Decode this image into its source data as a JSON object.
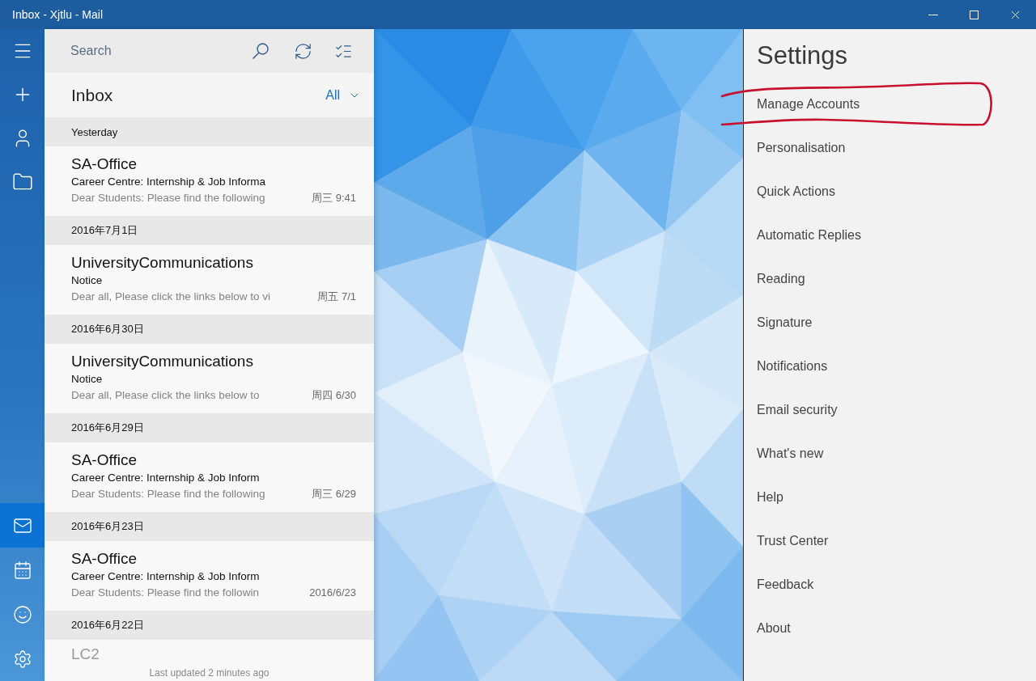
{
  "window": {
    "title": "Inbox - Xjtlu - Mail"
  },
  "nav_rail": {
    "apps": [
      {
        "kind": "mail",
        "selected": true
      },
      {
        "kind": "calendar",
        "selected": false
      },
      {
        "kind": "feedback",
        "selected": false
      },
      {
        "kind": "settings",
        "selected": false
      }
    ]
  },
  "message_list": {
    "search": {
      "placeholder": "Search"
    },
    "folder": "Inbox",
    "filter": "All",
    "groups": [
      {
        "heading": "Yesterday",
        "messages": [
          {
            "kind": "full",
            "sender": "SA-Office",
            "subject": "Career Centre: Internship & Job Informa",
            "preview": "Dear Students: Please find the following",
            "date": "周三 9:41"
          }
        ]
      },
      {
        "heading": "2016年7月1日",
        "messages": [
          {
            "kind": "full",
            "sender": "UniversityCommunications",
            "subject": "Notice",
            "preview": "Dear all, Please click the links below to vi",
            "date": "周五 7/1"
          }
        ]
      },
      {
        "heading": "2016年6月30日",
        "messages": [
          {
            "kind": "full",
            "sender": "UniversityCommunications",
            "subject": "Notice",
            "preview": "Dear all, Please click the links below to",
            "date": "周四 6/30"
          }
        ]
      },
      {
        "heading": "2016年6月29日",
        "messages": [
          {
            "kind": "full",
            "sender": "SA-Office",
            "subject": "Career Centre: Internship & Job Inform",
            "preview": "Dear Students: Please find the following",
            "date": "周三 6/29"
          }
        ]
      },
      {
        "heading": "2016年6月23日",
        "messages": [
          {
            "kind": "full",
            "sender": "SA-Office",
            "subject": "Career Centre: Internship & Job Inform",
            "preview": "Dear Students: Please find the followin",
            "date": "2016/6/23"
          }
        ]
      },
      {
        "heading": "2016年6月22日",
        "messages": [
          {
            "kind": "partial",
            "sender": "LC2"
          }
        ]
      }
    ],
    "status": "Last updated 2 minutes ago"
  },
  "settings": {
    "title": "Settings",
    "items": [
      {
        "label": "Manage Accounts",
        "circled": true
      },
      {
        "label": "Personalisation",
        "circled": false
      },
      {
        "label": "Quick Actions",
        "circled": false
      },
      {
        "label": "Automatic Replies",
        "circled": false
      },
      {
        "label": "Reading",
        "circled": false
      },
      {
        "label": "Signature",
        "circled": false
      },
      {
        "label": "Notifications",
        "circled": false
      },
      {
        "label": "Email security",
        "circled": false
      },
      {
        "label": "What's new",
        "circled": false
      },
      {
        "label": "Help",
        "circled": false
      },
      {
        "label": "Trust Center",
        "circled": false
      },
      {
        "label": "Feedback",
        "circled": false
      },
      {
        "label": "About",
        "circled": false
      }
    ]
  }
}
